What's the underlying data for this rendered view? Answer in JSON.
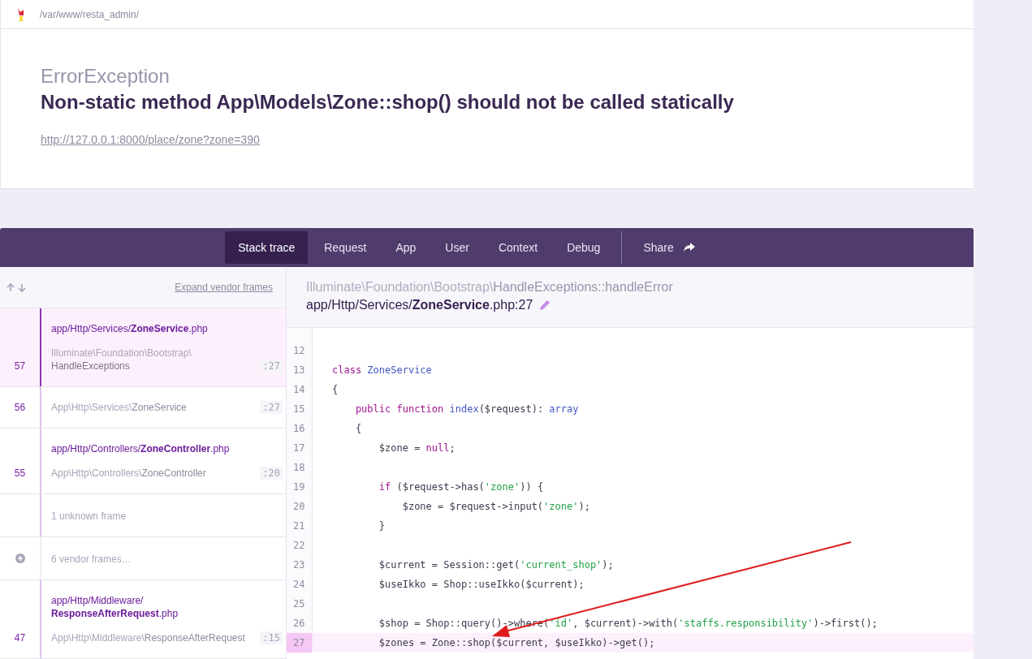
{
  "top_bar": {
    "path": "/var/www/resta_admin/"
  },
  "exception": {
    "class": "ErrorException",
    "message": "Non-static method App\\Models\\Zone::shop() should not be called statically",
    "url": "http://127.0.0.1:8000/place/zone?zone=390"
  },
  "tabs": [
    {
      "label": "Stack trace",
      "selected": true
    },
    {
      "label": "Request",
      "selected": false
    },
    {
      "label": "App",
      "selected": false
    },
    {
      "label": "User",
      "selected": false
    },
    {
      "label": "Context",
      "selected": false
    },
    {
      "label": "Debug",
      "selected": false
    }
  ],
  "share": {
    "label": "Share"
  },
  "frames_toolbar": {
    "expand_link": "Expand vendor frames"
  },
  "frames": [
    {
      "kind": "app",
      "number": "57",
      "path": "app/Http/Services/",
      "file": "**ZoneService**.php",
      "namespace": "Illuminate\\Foundation\\Bootstrap\\",
      "name": "HandleExceptions",
      "line": ":27",
      "selected": true
    },
    {
      "kind": "app",
      "number": "56",
      "namespace": "App\\Http\\Services\\",
      "name": "ZoneService",
      "line": ":27",
      "selected": false
    },
    {
      "kind": "app",
      "number": "55",
      "path": "app/Http/Controllers/",
      "file": "**ZoneController**.php",
      "namespace": "App\\Http\\Controllers\\",
      "name": "ZoneController",
      "line": ":20",
      "selected": false
    },
    {
      "kind": "unknown",
      "label": "1 unknown frame"
    },
    {
      "kind": "vendor",
      "label": "6 vendor frames…"
    },
    {
      "kind": "app",
      "number": "47",
      "path": "app/Http/Middleware/",
      "file": "**ResponseAfterRequest**.php",
      "namespace": "App\\Http\\Middleware\\",
      "name": "ResponseAfterRequest",
      "line": ":15",
      "selected": false
    }
  ],
  "code": {
    "namespace": "Illuminate\\Foundation\\Bootstrap\\",
    "method": "HandleExceptions::handleError",
    "file": "app/Http/Services/**ZoneService**.php:27",
    "lines": [
      {
        "number": "12",
        "highlighted": false
      },
      {
        "number": "13",
        "highlighted": false,
        "tokens": [
          {
            "kind": "keyword",
            "text": "class"
          },
          {
            "kind": "name",
            "text": " ZoneService"
          }
        ]
      },
      {
        "number": "14",
        "highlighted": false,
        "tokens": [
          {
            "kind": "plain",
            "text": "{"
          }
        ]
      },
      {
        "number": "15",
        "highlighted": false,
        "tokens": [
          {
            "kind": "keyword",
            "text": "    public function"
          },
          {
            "kind": "name",
            "text": " index"
          },
          {
            "kind": "plain",
            "text": "($request): "
          },
          {
            "kind": "name",
            "text": "array"
          }
        ]
      },
      {
        "number": "16",
        "highlighted": false,
        "tokens": [
          {
            "kind": "plain",
            "text": "    {"
          }
        ]
      },
      {
        "number": "17",
        "highlighted": false,
        "tokens": [
          {
            "kind": "plain",
            "text": "        $zone = "
          },
          {
            "kind": "keyword",
            "text": "null"
          },
          {
            "kind": "plain",
            "text": ";"
          }
        ]
      },
      {
        "number": "18",
        "highlighted": false
      },
      {
        "number": "19",
        "highlighted": false,
        "tokens": [
          {
            "kind": "keyword",
            "text": "        if"
          },
          {
            "kind": "plain",
            "text": " ($request->has("
          },
          {
            "kind": "string",
            "text": "'zone'"
          },
          {
            "kind": "plain",
            "text": ")) {"
          }
        ]
      },
      {
        "number": "20",
        "highlighted": false,
        "tokens": [
          {
            "kind": "plain",
            "text": "            $zone = $request->input("
          },
          {
            "kind": "string",
            "text": "'zone'"
          },
          {
            "kind": "plain",
            "text": ");"
          }
        ]
      },
      {
        "number": "21",
        "highlighted": false,
        "tokens": [
          {
            "kind": "plain",
            "text": "        }"
          }
        ]
      },
      {
        "number": "22",
        "highlighted": false
      },
      {
        "number": "23",
        "highlighted": false,
        "tokens": [
          {
            "kind": "plain",
            "text": "        $current = Session::get("
          },
          {
            "kind": "string",
            "text": "'current_shop'"
          },
          {
            "kind": "plain",
            "text": ");"
          }
        ]
      },
      {
        "number": "24",
        "highlighted": false,
        "tokens": [
          {
            "kind": "plain",
            "text": "        $useIkko = Shop::useIkko($current);"
          }
        ]
      },
      {
        "number": "25",
        "highlighted": false
      },
      {
        "number": "26",
        "highlighted": false,
        "tokens": [
          {
            "kind": "plain",
            "text": "        $shop = Shop::query()->where("
          },
          {
            "kind": "string",
            "text": "'id'"
          },
          {
            "kind": "plain",
            "text": ", $current)->with("
          },
          {
            "kind": "string",
            "text": "'staffs.responsibility'"
          },
          {
            "kind": "plain",
            "text": ")->first();"
          }
        ]
      },
      {
        "number": "27",
        "highlighted": true,
        "tokens": [
          {
            "kind": "plain",
            "text": "        $zones = Zone::shop($current, $useIkko)->get();"
          }
        ]
      }
    ]
  }
}
